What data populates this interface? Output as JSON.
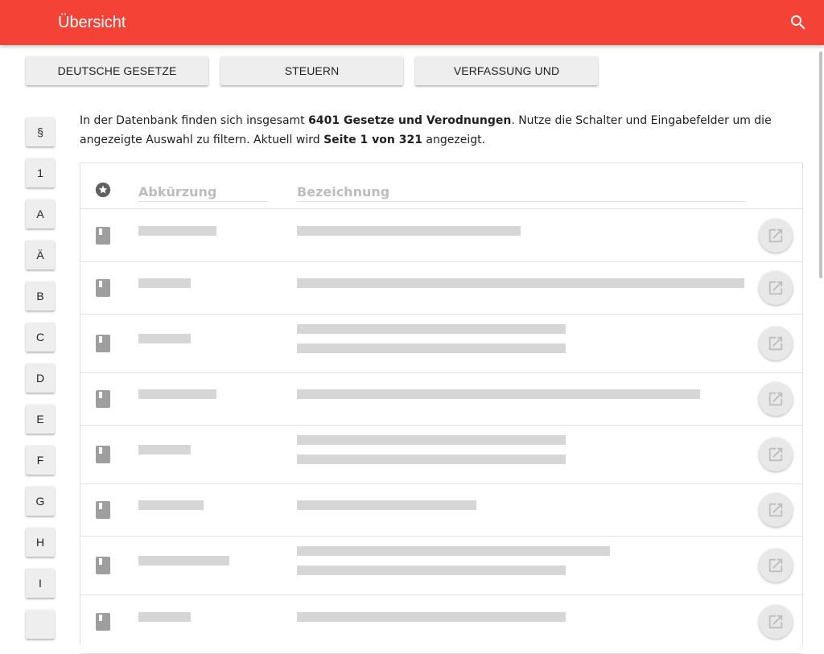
{
  "header": {
    "title": "Übersicht",
    "search_icon": "search-icon",
    "accent": "#f44336"
  },
  "filters": [
    {
      "label": "DEUTSCHE GESETZE"
    },
    {
      "label": "STEUERN"
    },
    {
      "label": "VERFASSUNG UND"
    }
  ],
  "letters": [
    "§",
    "1",
    "A",
    "Ä",
    "B",
    "C",
    "D",
    "E",
    "F",
    "G",
    "H",
    "I"
  ],
  "intro": {
    "p1": "In der Datenbank finden sich insgesamt ",
    "count": "6401 Gesetze und Verodnungen",
    "p2": ". Nutze die Schalter und Eingabefelder um die angezeigte Auswahl zu filtern.  Aktuell wird ",
    "page": "Seite 1 von 321",
    "p3": " angezeigt."
  },
  "table": {
    "favorite_icon": "star-circle-icon",
    "col_abbr": "Abkürzung",
    "col_name": "Bezeichnung",
    "row_icon": "book-icon",
    "action_icon": "open-in-new-icon",
    "row_count_visible": 8
  }
}
